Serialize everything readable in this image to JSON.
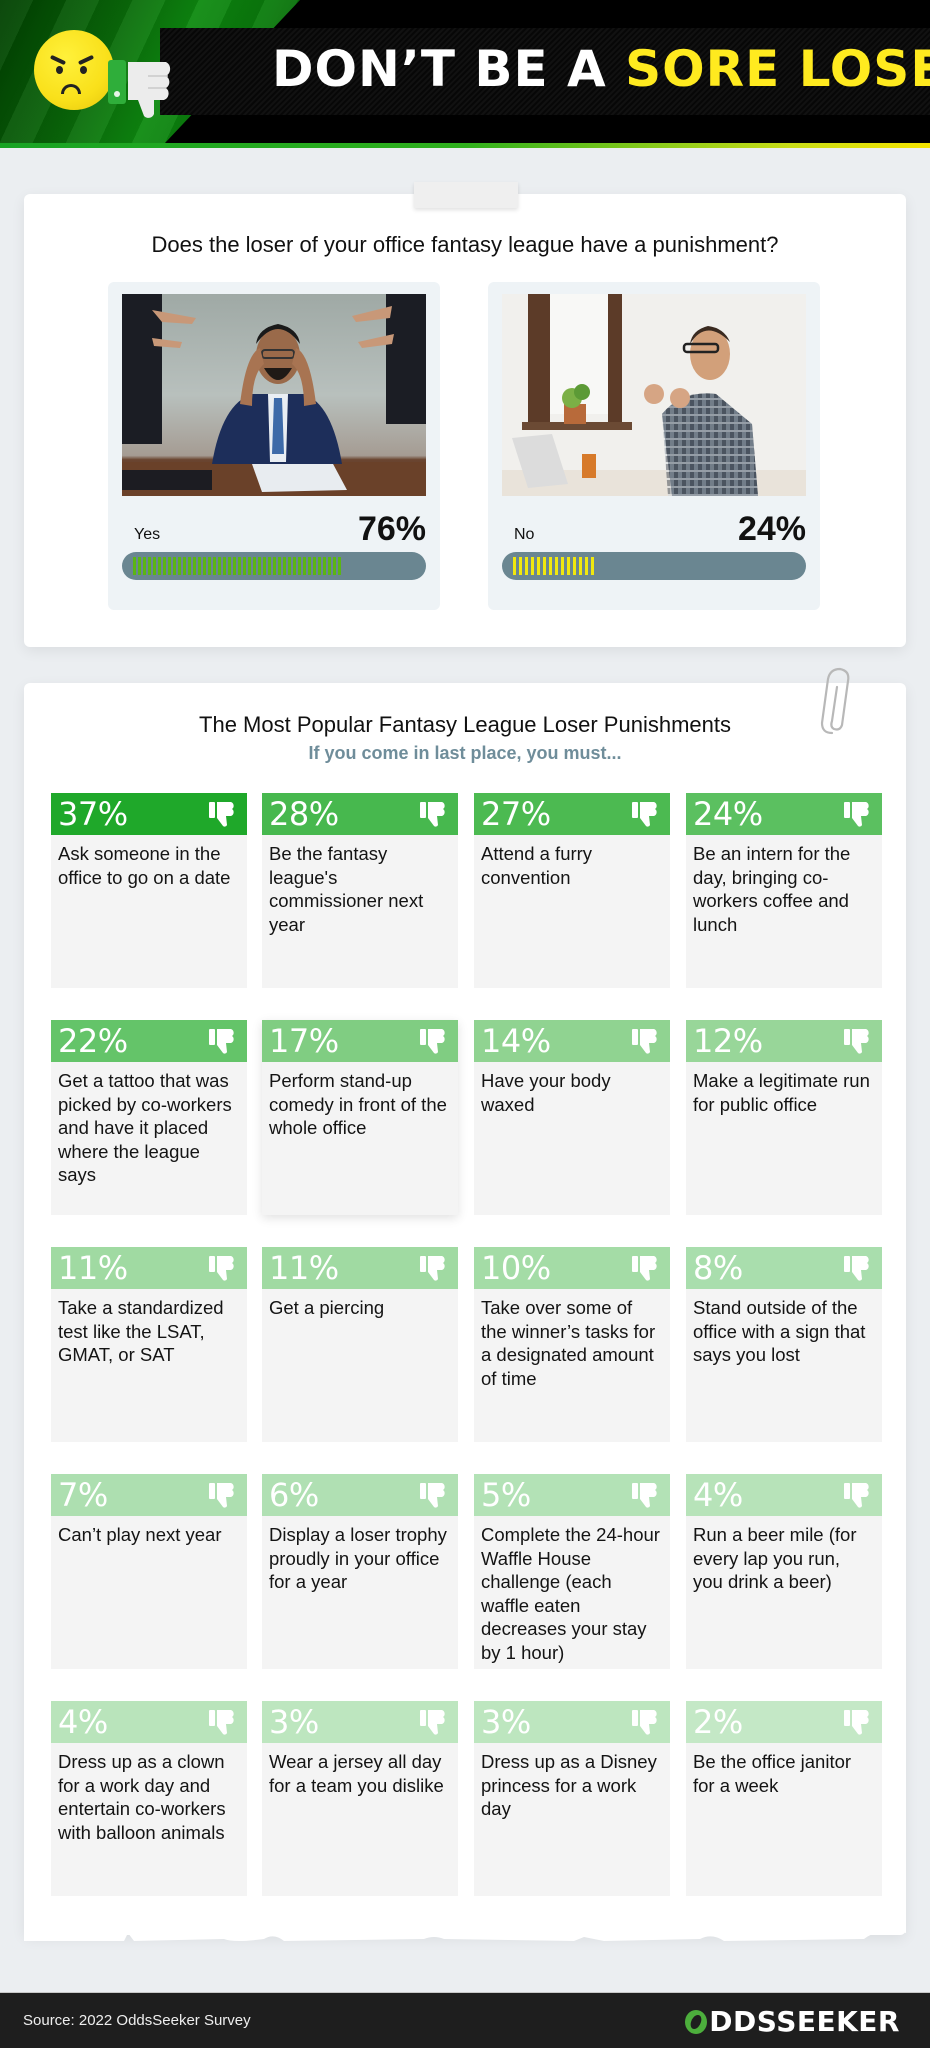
{
  "header": {
    "title_part1": "DON’T BE A ",
    "title_accent": "SORE LOSER",
    "emoji_icon": "angry-face-icon",
    "thumb_icon": "thumbs-down-icon",
    "colors": {
      "accent": "#ffea1f",
      "brand_green": "#1fa82a"
    }
  },
  "poll": {
    "question": "Does the loser of your office fantasy league have a punishment?",
    "options": [
      {
        "label": "Yes",
        "percent_text": "76%",
        "value": 76,
        "image": "stressed businessman being pointed at",
        "bar_color": "#5bb514"
      },
      {
        "label": "No",
        "percent_text": "24%",
        "value": 24,
        "image": "happy man celebrating at laptop",
        "bar_color": "#f1e80e"
      }
    ]
  },
  "punishments": {
    "title": "The Most Popular Fantasy League Loser Punishments",
    "subtitle": "If you come in last place, you must...",
    "items": [
      {
        "pct": "37%",
        "text": "Ask someone in the office to go on a date",
        "color": "#1fa82a"
      },
      {
        "pct": "28%",
        "text": "Be the fantasy league's commissioner next year",
        "color": "#47b84e"
      },
      {
        "pct": "27%",
        "text": "Attend a furry convention",
        "color": "#4cba51"
      },
      {
        "pct": "24%",
        "text": "Be an intern for the day, bringing co-workers coffee and lunch",
        "color": "#5bc060"
      },
      {
        "pct": "22%",
        "text": "Get a tattoo that was picked by co-workers and have it placed where the league says",
        "color": "#64c469"
      },
      {
        "pct": "17%",
        "text": "Perform stand-up comedy in front of the whole office",
        "color": "#80cd82"
      },
      {
        "pct": "14%",
        "text": "Have your body waxed",
        "color": "#90d391"
      },
      {
        "pct": "12%",
        "text": "Make a legitimate run for public office",
        "color": "#98d699"
      },
      {
        "pct": "11%",
        "text": "Take a standardized test like the LSAT, GMAT, or SAT",
        "color": "#a0daa2"
      },
      {
        "pct": "11%",
        "text": "Get a piercing",
        "color": "#a0daa2"
      },
      {
        "pct": "10%",
        "text": "Take over some of the winner’s tasks for a designated amount of time",
        "color": "#a4dca6"
      },
      {
        "pct": "8%",
        "text": "Stand outside of the office with a sign that says you lost",
        "color": "#a9dead"
      },
      {
        "pct": "7%",
        "text": "Can’t play next year",
        "color": "#addfb0"
      },
      {
        "pct": "6%",
        "text": "Display a loser trophy proudly in your office for a year",
        "color": "#b0e0b3"
      },
      {
        "pct": "5%",
        "text": "Complete the 24-hour Waffle House challenge (each waffle eaten decreases your stay by 1 hour)",
        "color": "#b3e2b6"
      },
      {
        "pct": "4%",
        "text": "Run a beer mile (for every lap you run, you drink a beer)",
        "color": "#b7e3b9"
      },
      {
        "pct": "4%",
        "text": "Dress up as a clown for a work day and entertain co-workers with balloon animals",
        "color": "#b9e4bb"
      },
      {
        "pct": "3%",
        "text": "Wear a jersey all day for a team you dislike",
        "color": "#bde6bf"
      },
      {
        "pct": "3%",
        "text": "Dress up as a Disney princess for a work day",
        "color": "#bde6bf"
      },
      {
        "pct": "2%",
        "text": "Be the office janitor for a week",
        "color": "#c4e8c6"
      }
    ]
  },
  "footer": {
    "source": "Source: 2022 OddsSeeker Survey",
    "logo_text": "DDSSEEKER",
    "logo_icon": "oddsseeker-o-icon"
  }
}
